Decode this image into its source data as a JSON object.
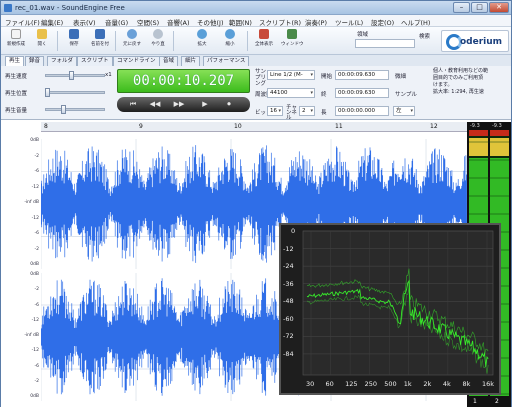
{
  "window": {
    "title": "rec_01.wav - SoundEngine Free",
    "minimize": "–",
    "maximize": "□",
    "close": "✕"
  },
  "menu": [
    "ファイル(F)",
    "編集(E)",
    "表示(V)",
    "音量(G)",
    "空間(S)",
    "音響(A)",
    "その他(J)",
    "範囲(N)",
    "スクリプト(R)",
    "演奏(P)",
    "ツール(L)",
    "設定(O)",
    "ヘルプ(H)"
  ],
  "toolbar": {
    "buttons": [
      {
        "label": "新規作成",
        "icon": "new-file-icon",
        "color": "#f4f4f4"
      },
      {
        "label": "開く",
        "icon": "open-folder-icon",
        "color": "#e9c04a"
      },
      {
        "label": "保存",
        "icon": "save-icon",
        "color": "#3c6fb8"
      },
      {
        "label": "名前を付",
        "icon": "save-as-icon",
        "color": "#3c6fb8"
      },
      {
        "label": "元に戻す",
        "icon": "undo-icon",
        "color": "#6aa0d8"
      },
      {
        "label": "やり直",
        "icon": "redo-icon",
        "color": "#b8c3d0"
      },
      {
        "label": "拡大",
        "icon": "zoom-in-icon",
        "color": "#5a9fd8"
      },
      {
        "label": "縮小",
        "icon": "zoom-out-icon",
        "color": "#5a9fd8"
      },
      {
        "label": "全体表示",
        "icon": "fit-view-icon",
        "color": "#c84a3a"
      },
      {
        "label": "ウィンドウ",
        "icon": "window-icon",
        "color": "#4a8a4a"
      }
    ],
    "bookmark_label": "領域",
    "search_label": "検索",
    "logo_text": "oderium"
  },
  "tabs": [
    "再生",
    "録音",
    "フォルダ",
    "スクリプト",
    "コマンドライン",
    "音域",
    "細片",
    "パフォーマンス"
  ],
  "panel": {
    "playback_speed_label": "再生速度",
    "playback_position_label": "再生位置",
    "playback_volume_label": "再生音量",
    "speed_max_label": "x1",
    "time": "00:00:10.207",
    "transport": [
      "⏮",
      "◀◀",
      "▶▶",
      "▶",
      "⏺"
    ],
    "sampling_label": "サンプリング",
    "sampling_value": "Line 1/2 (M-",
    "frequency_label": "周波数",
    "frequency_value": "44100",
    "bits_label": "ビット",
    "bits_value": "16",
    "channels_label": "チャンネル",
    "channels_value": "2",
    "start_label": "開始",
    "start_value": "00:00:09.630",
    "end_label": "終",
    "end_value": "00:00:09.630",
    "length_label": "長",
    "length_value": "00:00:00.000",
    "unit_label": "左",
    "end_mode_label": "微細",
    "sample_label": "サンプル",
    "notice": [
      "個人・教育利用などの範",
      "囲目的でのみご利用頂",
      "けます。",
      "拡大率: 1:294, 再生速"
    ]
  },
  "ruler": {
    "marks": [
      "8",
      "9",
      "10",
      "11",
      "12"
    ]
  },
  "yaxis": {
    "top": [
      "0dB",
      "-2",
      "-6",
      "-12",
      "-inf dB",
      "-12",
      "-6",
      "-2",
      "0dB"
    ],
    "bottom": [
      "0dB",
      "-2",
      "-6",
      "-12",
      "-inf dB",
      "-12",
      "-6",
      "-2",
      "0dB"
    ]
  },
  "meter": {
    "top_labels": [
      "-9.3",
      "-9.3"
    ],
    "channels": [
      "1",
      "2"
    ],
    "accent": "#39d32a"
  },
  "spectrum": {
    "y_labels": [
      "0",
      "-12",
      "-24",
      "-36",
      "-48",
      "-60",
      "-72",
      "-84"
    ],
    "x_labels": [
      "30",
      "60",
      "125",
      "250",
      "500",
      "1k",
      "2k",
      "4k",
      "8k",
      "16k"
    ],
    "line_color": "#39ff2a"
  },
  "colors": {
    "wave": "#2f6ee8",
    "time_bg": "#5acc32"
  }
}
